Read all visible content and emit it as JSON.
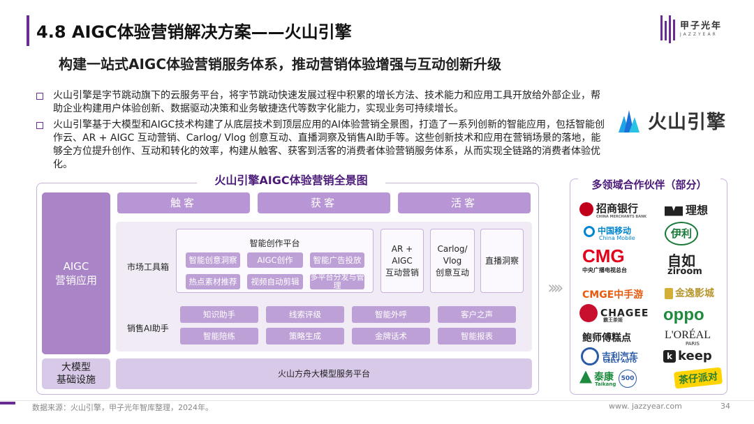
{
  "header": {
    "title": "4.8 AIGC体验营销解决方案——火山引擎",
    "logo_cn": "甲子光年",
    "logo_en": "JAZZYEAR",
    "accent_color": "#6a2c91"
  },
  "subtitle": "构建一站式AIGC体验营销服务体系，推动营销体验增强与互动创新升级",
  "bullets": [
    "火山引擎是字节跳动旗下的云服务平台，将字节跳动快速发展过程中积累的增长方法、技术能力和应用工具开放给外部企业，帮助企业构建用户体验创新、数据驱动决策和业务敏捷迭代等数字化能力，实现业务可持续增长。",
    "火山引擎基于大模型和AIGC技术构建了从底层技术到顶层应用的AI体验营销全景图，打造了一系列创新的智能应用，包括智能创作云、AR + AIGC 互动营销、Carlog/ Vlog 创意互动、直播洞察及销售AI助手等。这些创新技术和应用在营销场景的落地，能够全方位提升创作、互动和转化的效率，构建从触客、获客到活客的消费者体验营销服务体系，从而实现全链路的消费者体验优化。"
  ],
  "volc_logo": "火山引擎",
  "panorama": {
    "title": "火山引擎AIGC体验营销全景图",
    "left_app": "AIGC\n营销应用",
    "left_base": "大模型\n基础设施",
    "tabs": [
      "触客",
      "获客",
      "活客"
    ],
    "tools_label": "市场工具箱",
    "creative_platform": "智能创作平台",
    "creative_chips": [
      "智能创意洞察",
      "AIGC创作",
      "智能广告投放",
      "热点素材推荐",
      "视频自动剪辑",
      "多平台分发与管理"
    ],
    "ar_box": "AR +\nAIGC\n互动营销",
    "carlog_box": "Carlog/\nVlog\n创意互动",
    "live_box": "直播洞察",
    "ai_label": "销售AI助手",
    "ai_chips": [
      "知识助手",
      "线索评级",
      "智能外呼",
      "客户之声",
      "智能陪练",
      "策略生成",
      "金牌话术",
      "智能报表"
    ],
    "base_platform": "火山方舟大模型服务平台"
  },
  "partners": {
    "title": "多领域合作伙伴（部分）",
    "logos": {
      "cmb": "招商银行",
      "cmb_en": "CHINA MERCHANTS BANK",
      "lixiang": "理想",
      "cmcc": "中国移动",
      "cmcc_en": "China Mobile",
      "yili": "伊利",
      "cmg": "CMG",
      "cmg_cn": "中央广播电视总台",
      "ziroom_cn": "自如",
      "ziroom": "ziroom",
      "cmge": "CMGE中手游",
      "jinyi": "金逸影城",
      "chagee": "CHAGEE",
      "chagee_cn": "霸王茶姬",
      "oppo": "oppo",
      "baoshifu": "鲍师傅糕点",
      "loreal": "L'ORÉAL",
      "loreal_sub": "PARIS",
      "geely": "吉利汽车",
      "geely_en": "GEELY AUTO",
      "keep": "keep",
      "taikang": "泰康",
      "taikang_en": "Taikang",
      "fortune": "500",
      "chazai": "茶仔派对"
    }
  },
  "footer": {
    "source": "数据来源：火山引擎，甲子光年智库整理，2024年。",
    "site": "www. jazzyear.com",
    "page": "34"
  }
}
